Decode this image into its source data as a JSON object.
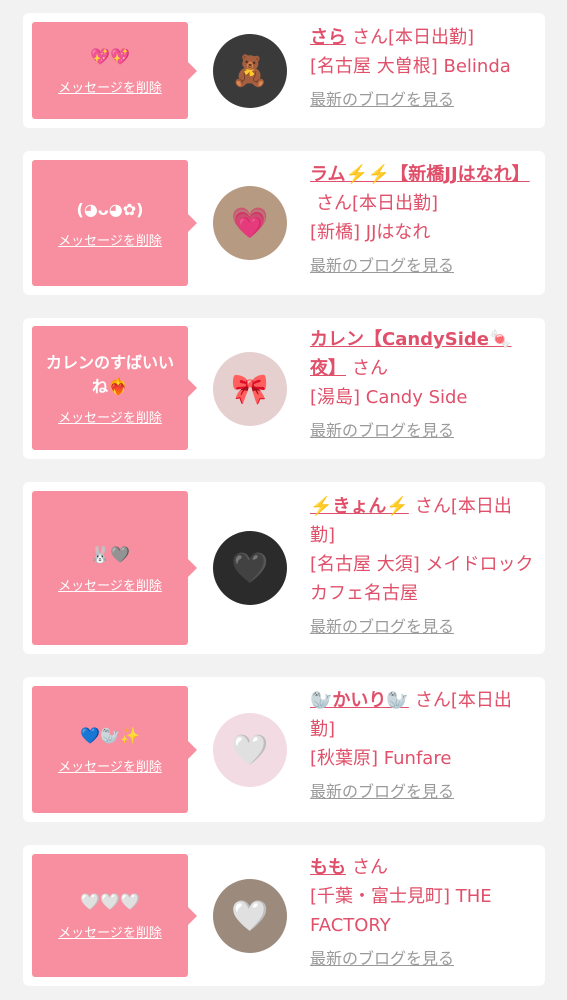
{
  "delete_label": "メッセージを削除",
  "san_suffix": "さん",
  "blog_label": "最新のブログを見る",
  "colors": {
    "accent": "#f78fa0",
    "name": "#e0506a",
    "link_gray": "#9a9a9a"
  },
  "items": [
    {
      "message": "💖💖",
      "name": "さら",
      "status": "[本日出勤]",
      "shop": "[名古屋 大曽根] Belinda",
      "avatar_icon": "🧸"
    },
    {
      "message": "(◕ᴗ◕✿)",
      "name": "ラム⚡️⚡️【新橋JJはなれ】",
      "status": "[本日出勤]",
      "shop": "[新橋] JJはなれ",
      "avatar_icon": "💗"
    },
    {
      "message": "カレンのすばいいね❤️‍🔥",
      "name": "カレン【CandySide🍬夜】",
      "status": "",
      "shop": "[湯島] Candy Side",
      "avatar_icon": "🎀"
    },
    {
      "message": "🐰🩶",
      "name": "⚡️きょん⚡️",
      "status": "[本日出勤]",
      "shop": "[名古屋 大須] メイドロックカフェ名古屋",
      "avatar_icon": "🖤"
    },
    {
      "message": "💙🦭✨",
      "name": "🦭かいり🦭",
      "status": "[本日出勤]",
      "shop": "[秋葉原] Funfare",
      "avatar_icon": "🤍"
    },
    {
      "message": "🤍🤍🤍",
      "name": "もも",
      "status": "",
      "shop": "[千葉・富士見町] THE FACTORY",
      "avatar_icon": "🤍"
    }
  ]
}
